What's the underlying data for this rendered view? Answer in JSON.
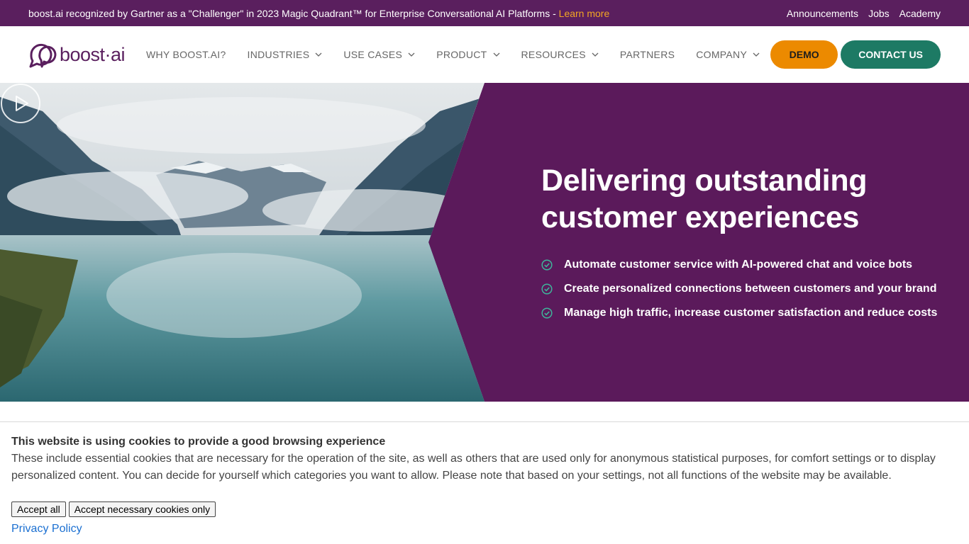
{
  "announcement": {
    "text": "boost.ai recognized by Gartner as a \"Challenger\" in 2023 Magic Quadrant™ for Enterprise Conversational AI Platforms - ",
    "link": "Learn more",
    "link_color": "#f3a623"
  },
  "utility_links": [
    "Announcements",
    "Jobs",
    "Academy"
  ],
  "brand": {
    "name": "boost·ai",
    "color": "#5a1f5e"
  },
  "nav": {
    "items": [
      {
        "label": "WHY BOOST.AI?",
        "dropdown": false
      },
      {
        "label": "INDUSTRIES",
        "dropdown": true
      },
      {
        "label": "USE CASES",
        "dropdown": true
      },
      {
        "label": "PRODUCT",
        "dropdown": true
      },
      {
        "label": "RESOURCES",
        "dropdown": true
      },
      {
        "label": "PARTNERS",
        "dropdown": false
      },
      {
        "label": "COMPANY",
        "dropdown": true
      }
    ],
    "demo_label": "DEMO",
    "contact_label": "CONTACT US"
  },
  "hero": {
    "title_line1": "Delivering outstanding",
    "title_line2": "customer experiences",
    "bullets": [
      "Automate customer service with AI-powered chat and voice bots",
      "Create personalized connections between customers and your brand",
      "Manage high traffic, increase customer satisfaction and reduce costs"
    ],
    "background_color": "#5b1a5b",
    "check_color": "#3fb39a",
    "media_icon": "play-icon"
  },
  "cookie": {
    "title": "This website is using cookies to provide a good browsing experience",
    "text": "These include essential cookies that are necessary for the operation of the site, as well as others that are used only for anonymous statistical purposes, for comfort settings or to display personalized content. You can decide for yourself which categories you want to allow. Please note that based on your settings, not all functions of the website may be available.",
    "accept_all": "Accept all",
    "accept_necessary": "Accept necessary cookies only",
    "privacy": "Privacy Policy"
  },
  "colors": {
    "demo_button": "#ec8a00",
    "contact_button": "#1d7a64",
    "topbar": "#5a1f5e"
  }
}
